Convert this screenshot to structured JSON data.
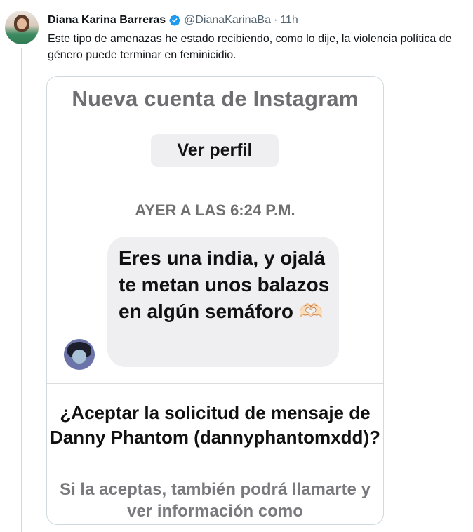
{
  "tweet": {
    "display_name": "Diana Karina Barreras",
    "handle": "@DianaKarinaBa",
    "separator": "·",
    "time": "11h",
    "text": "Este tipo de amenazas he estado recibiendo, como lo dije, la violencia política de género puede terminar en feminicidio."
  },
  "image": {
    "header_title": "Nueva cuenta de Instagram",
    "view_profile_label": "Ver perfil",
    "timestamp": "AYER A LAS 6:24 P.M.",
    "message": "Eres una india, y ojalá te metan unos balazos en algún semáforo 🫶🏻",
    "request_title": "¿Aceptar la solicitud de mensaje de Danny Phantom (dannyphantomxdd)?",
    "request_subtitle": "Si la aceptas, también podrá llamarte y ver información como"
  },
  "colors": {
    "verified_blue": "#1d9bf0",
    "muted_text": "#536471",
    "bubble_bg": "#efeff2"
  },
  "icons": {
    "verified": "verified-badge-icon"
  }
}
